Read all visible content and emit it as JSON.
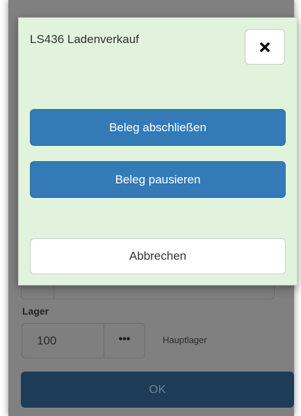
{
  "modal": {
    "title": "LS436 Ladenverkauf",
    "close_icon": "close-icon",
    "finish_label": "Beleg abschließen",
    "pause_label": "Beleg pausieren",
    "cancel_label": "Abbrechen"
  },
  "background_form": {
    "lager_label": "Lager",
    "lager_value": "100",
    "lager_picker_label": "•••",
    "lager_name": "Hauptlager",
    "ok_label": "OK"
  },
  "colors": {
    "modal_background": "#e1f3dd",
    "primary_button": "#337ab7",
    "ok_button_dimmed": "#1c3c57",
    "backdrop": "#808080"
  }
}
